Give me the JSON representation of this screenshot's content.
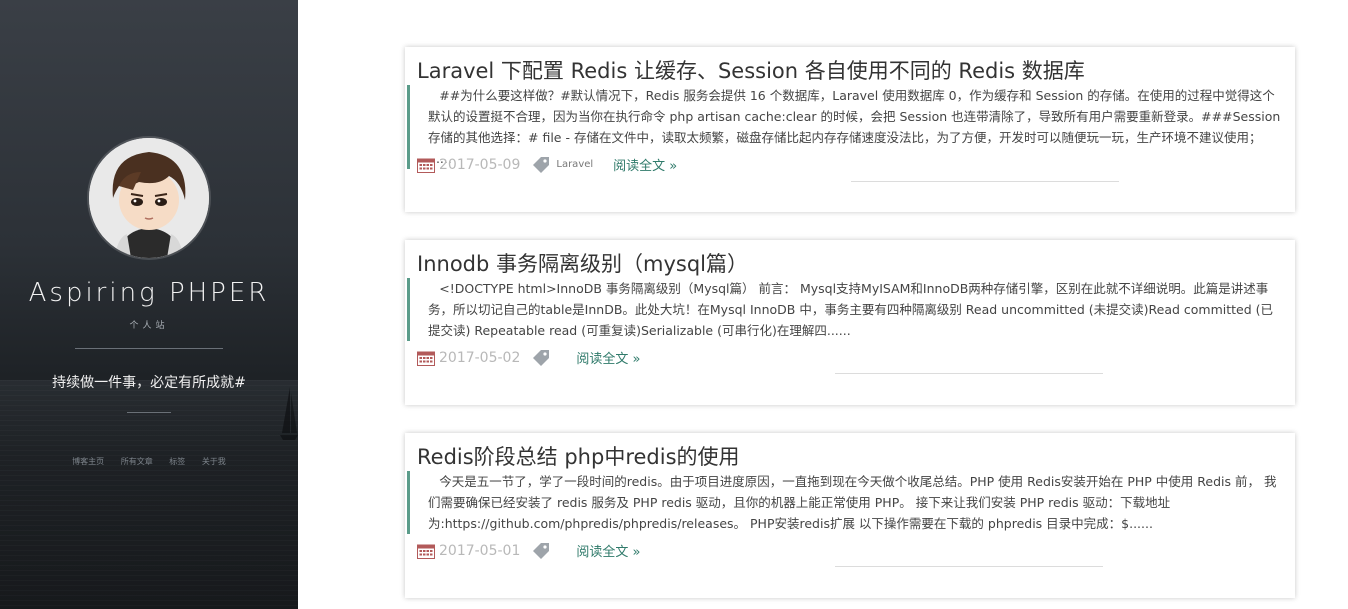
{
  "sidebar": {
    "site_title": "Aspiring PHPER",
    "site_subtitle": "个人站",
    "motto": "持续做一件事，必定有所成就#",
    "nav": [
      "博客主页",
      "所有文章",
      "标签",
      "关于我"
    ]
  },
  "posts": [
    {
      "title": "Laravel 下配置 Redis 让缓存、Session 各自使用不同的 Redis 数据库",
      "excerpt": "##为什么要这样做？#默认情况下，Redis 服务会提供 16 个数据库，Laravel 使用数据库 0，作为缓存和 Session 的存储。在使用的过程中觉得这个默认的设置挺不合理，因为当你在执行命令 php artisan cache:clear 的时候，会把 Session 也连带清除了，导致所有用户需要重新登录。###Session 存储的其他选择：# file - 存储在文件中，读取太频繁，磁盘存储比起内存存储速度没法比，为了方便，开发时可以随便玩一玩，生产环境不建议使用； ......",
      "date": "2017-05-09",
      "tag": "Laravel",
      "read_more": "阅读全文 »"
    },
    {
      "title": "Innodb 事务隔离级别（mysql篇）",
      "excerpt": "<!DOCTYPE html>InnoDB 事务隔离级别（Mysql篇） 前言： Mysql支持MyISAM和InnoDB两种存储引擎，区别在此就不详细说明。此篇是讲述事务，所以切记自己的table是InnDB。此处大坑！在Mysql InnoDB 中，事务主要有四种隔离级别 Read uncommitted (未提交读)Read committed (已提交读) Repeatable read (可重复读)Serializable (可串行化)在理解四......",
      "date": "2017-05-02",
      "tag": "",
      "read_more": "阅读全文 »"
    },
    {
      "title": "Redis阶段总结 php中redis的使用",
      "excerpt": "今天是五一节了，学了一段时间的redis。由于项目进度原因，一直拖到现在今天做个收尾总结。PHP 使用 Redis安装开始在 PHP 中使用 Redis 前， 我们需要确保已经安装了 redis 服务及 PHP redis 驱动，且你的机器上能正常使用 PHP。 接下来让我们安装 PHP redis 驱动：下载地址为:https://github.com/phpredis/phpredis/releases。 PHP安装redis扩展 以下操作需要在下载的 phpredis 目录中完成：$......",
      "date": "2017-05-01",
      "tag": "",
      "read_more": "阅读全文 »"
    }
  ]
}
